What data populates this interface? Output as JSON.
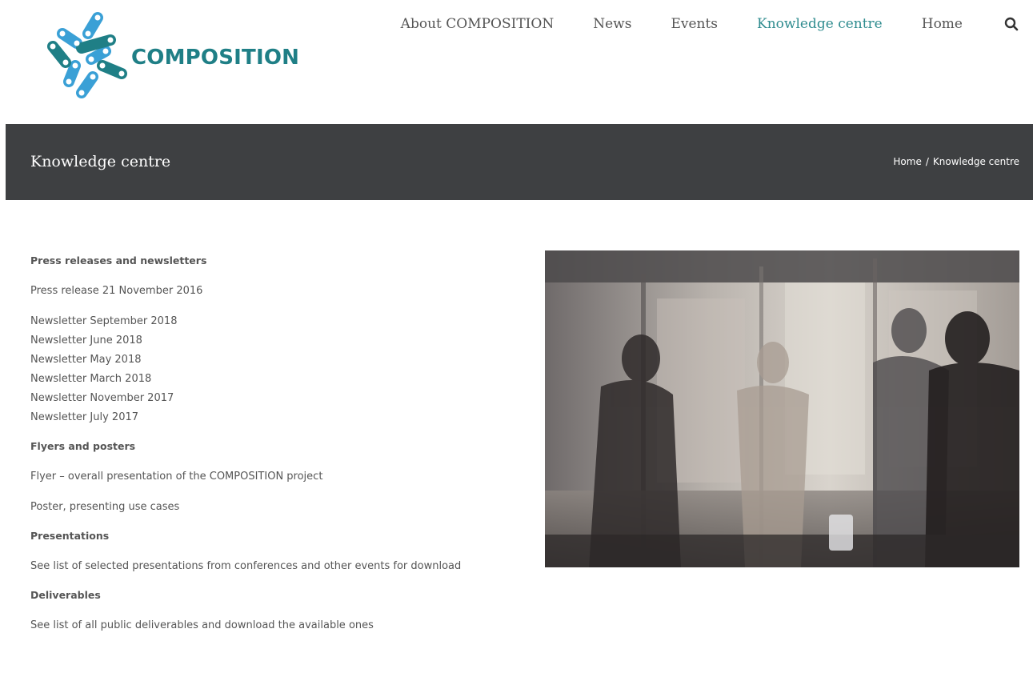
{
  "header": {
    "logo_text": "COMPOSITION",
    "nav": [
      {
        "label": "About COMPOSITION",
        "active": false
      },
      {
        "label": "News",
        "active": false
      },
      {
        "label": "Events",
        "active": false
      },
      {
        "label": "Knowledge centre",
        "active": true
      },
      {
        "label": "Home",
        "active": false
      }
    ],
    "search_icon": "search-icon"
  },
  "title_bar": {
    "title": "Knowledge centre",
    "breadcrumb": {
      "home": "Home",
      "separator": "/",
      "current": "Knowledge centre"
    }
  },
  "content": {
    "press": {
      "heading": "Press releases and newsletters",
      "press_release": "Press release 21 November 2016",
      "newsletters": [
        "Newsletter September 2018",
        "Newsletter June 2018",
        "Newsletter May 2018",
        "Newsletter March 2018",
        "Newsletter November 2017",
        "Newsletter July 2017"
      ]
    },
    "flyers": {
      "heading": "Flyers and posters",
      "flyer": "Flyer – overall presentation of the COMPOSITION project",
      "poster": "Poster, presenting use cases"
    },
    "presentations": {
      "heading": "Presentations",
      "link": "See list of selected presentations from conferences and other events for download"
    },
    "deliverables": {
      "heading": "Deliverables",
      "link": "See list of all public deliverables and download the available ones"
    }
  },
  "colors": {
    "accent_teal": "#2f8c8f",
    "logo_blue": "#3aa0d6",
    "logo_teal": "#1f7f86",
    "title_bar_bg": "#3e4042"
  }
}
